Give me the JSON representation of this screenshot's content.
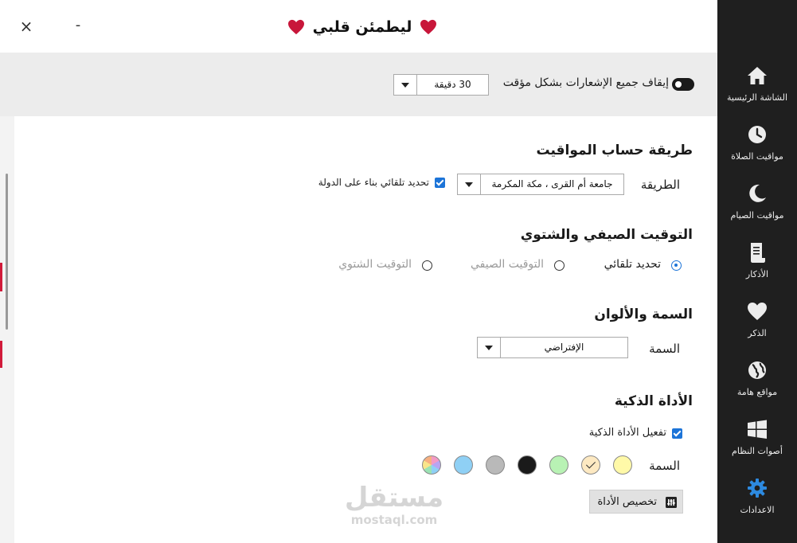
{
  "window": {
    "title": "ليطمئن قلبي",
    "close_glyph": "×",
    "minimize_glyph": "-"
  },
  "sidebar": {
    "items": [
      {
        "label": "الشاشة الرئيسية",
        "icon": "home-icon"
      },
      {
        "label": "مواقيت الصلاة",
        "icon": "clock-icon"
      },
      {
        "label": "مواقيت الصيام",
        "icon": "moon-icon"
      },
      {
        "label": "الأذكار",
        "icon": "scroll-icon"
      },
      {
        "label": "الذكر",
        "icon": "heart-icon"
      },
      {
        "label": "مواقع هامة",
        "icon": "globe-icon"
      },
      {
        "label": "أصوات النظام",
        "icon": "windows-icon"
      },
      {
        "label": "الاعدادات",
        "icon": "gear-icon"
      }
    ]
  },
  "notifications": {
    "pause_label": "إيقاف جميع الإشعارات بشكل مؤقت",
    "duration_value": "30 دقيقة"
  },
  "calculation": {
    "section_title": "طريقة حساب المواقيت",
    "method_label": "الطريقة",
    "method_value": "جامعة أم القرى ، مكة المكرمة",
    "auto_label": "تحديد تلقائي بناء على الدولة"
  },
  "timing": {
    "section_title": "التوقيت الصيفي والشتوي",
    "options": [
      "تحديد تلقائي",
      "التوقيت الصيفي",
      "التوقيت الشتوي"
    ],
    "selected_index": 0
  },
  "theme": {
    "section_title": "السمة والألوان",
    "theme_label": "السمة",
    "theme_value": "الإفتراضي"
  },
  "smart_tool": {
    "section_title": "الأداة الذكية",
    "enable_label": "تفعيل الأداة الذكية",
    "color_label": "السمة",
    "customize_label": "تخصيص الأداة",
    "swatches": [
      "#fff9a8",
      "#fde9c2",
      "#b8f2b4",
      "#1a1a1a",
      "#b9b9b9",
      "#8fd0f5",
      "multicolor"
    ],
    "selected_swatch": 1
  },
  "watermark": {
    "arabic": "مستقل",
    "latin": "mostaql.com"
  },
  "colors": {
    "sidebar_bg": "#1f1f1f",
    "accent": "#1c74d8",
    "heart": "#c8163a",
    "gear_active": "#2d8ae0"
  }
}
